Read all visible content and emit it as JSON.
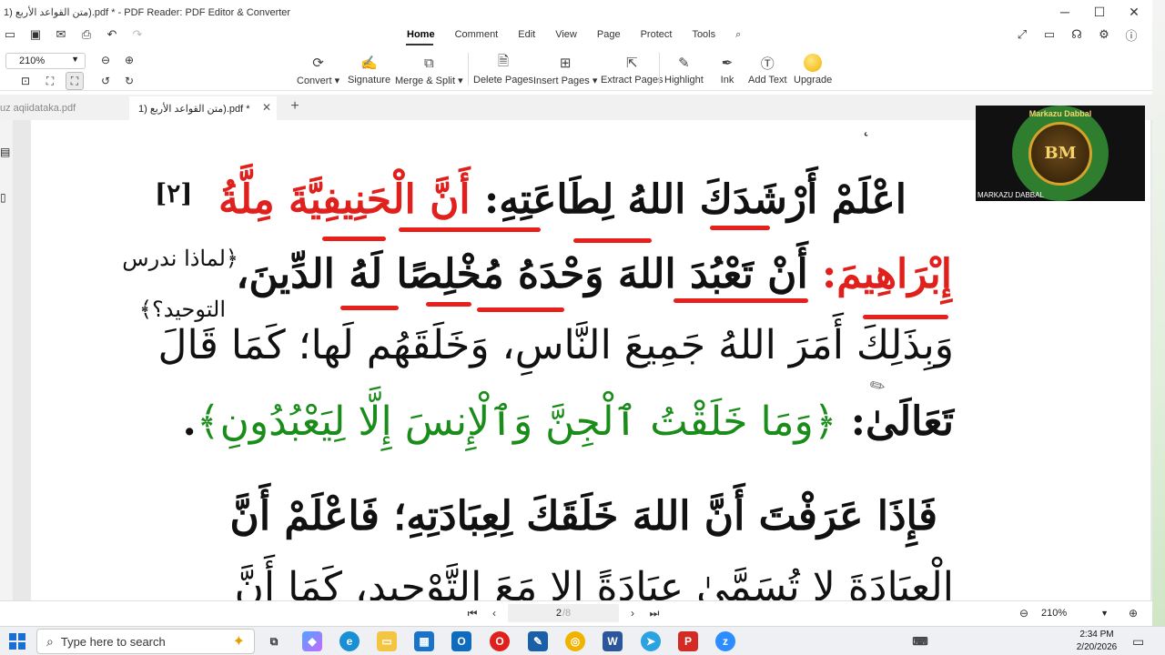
{
  "window": {
    "title": "1) متن القواعد الأربع).pdf * - PDF Reader: PDF Editor & Converter",
    "minimize": "─",
    "maximize": "☐",
    "close": "✕"
  },
  "menu": {
    "tabs": [
      "Home",
      "Comment",
      "Edit",
      "View",
      "Page",
      "Protect",
      "Tools"
    ],
    "active": "Home"
  },
  "ribbon": {
    "zoom": "210%",
    "tools": {
      "convert": "Convert",
      "signature": "Signature",
      "merge_split": "Merge & Split",
      "delete_pages": "Delete Pages",
      "insert_pages": "Insert Pages",
      "extract_pages": "Extract Pages",
      "highlight": "Highlight",
      "ink": "Ink",
      "add_text": "Add Text",
      "upgrade": "Upgrade"
    }
  },
  "tabs": {
    "inactive": "uz aqiidataka.pdf",
    "active": "1) متن القواعد الأربع).pdf *"
  },
  "page": {
    "page_marker": "[٢]",
    "side_note_line1": "﴿لماذا ندرس",
    "side_note_line2": "التوحيد؟﴾",
    "line1_black": "اعْلَمْ أَرْشَدَكَ اللهُ لِطَاعَتِهِ:",
    "line1_red": "أَنَّ الْحَنِيفِيَّةَ مِلَّةُ",
    "line2_red": "إِبْرَاهِيمَ:",
    "line2_black": "أَنْ تَعْبُدَ اللهَ وَحْدَهُ مُخْلِصًا لَهُ الدِّينَ،",
    "line3": "وَبِذَلِكَ أَمَرَ اللهُ جَمِيعَ النَّاسِ، وَخَلَقَهُم لَها؛ كَمَا قَالَ",
    "line4_black": "تَعَالَىٰ:",
    "line4_green": "﴿وَمَا خَلَقْتُ ٱلْجِنَّ وَٱلْإِنسَ إِلَّا لِيَعْبُدُونِ﴾",
    "line4_end": ".",
    "line5": "فَإِذَا عَرَفْتَ أَنَّ اللهَ خَلَقَكَ لِعِبَادَتِهِ؛ فَاعْلَمْ أَنَّ",
    "line6": "الْعِبَادَةَ لا تُسَمَّىٰ عِبَادَةً إلا مَعَ التَّوْحِيدِ، كَمَا أَنَّ"
  },
  "overlay": {
    "logo_arc_text": "Markazu Dabbal",
    "logo_initials": "BM",
    "caption": "MARKAZU DABBAL"
  },
  "status": {
    "current_page": "2",
    "total_pages": "/8",
    "zoom": "210%"
  },
  "taskbar": {
    "search_placeholder": "Type here to search",
    "time": "2:34 PM",
    "date": "2/20/2026"
  },
  "colors": {
    "accent_red": "#e0201c",
    "quran_green": "#1a8c1a"
  }
}
